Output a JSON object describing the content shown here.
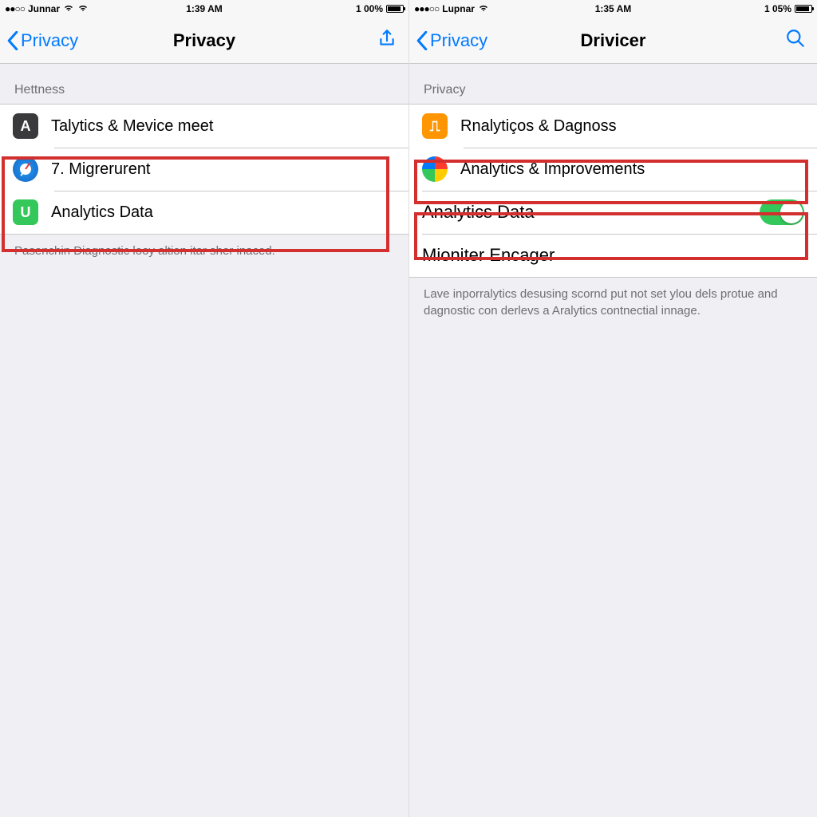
{
  "left": {
    "status": {
      "carrier": "Junnar",
      "signal": "●●○○",
      "time": "1:39 AM",
      "battery": "1 00%"
    },
    "nav": {
      "back": "Privacy",
      "title": "Privacy"
    },
    "section": "Hettness",
    "rows": [
      {
        "label": "Talytics & Mevice meet"
      },
      {
        "label": "7. Migrerurent"
      },
      {
        "label": "Analytics Data"
      }
    ],
    "footer": "Pasenchin Diagnostic looy altion itar sher inaced."
  },
  "right": {
    "status": {
      "carrier": "Lupnar",
      "signal": "●●●○○",
      "time": "1:35 AM",
      "battery": "1 05%"
    },
    "nav": {
      "back": "Privacy",
      "title": "Drivicer"
    },
    "section": "Privacy",
    "rows": [
      {
        "label": "Rnalytiços & Dagnoss"
      },
      {
        "label": "Analytics & Improvements"
      },
      {
        "label": "Analytics Data",
        "toggle": true
      },
      {
        "label": "Mioniter Encager"
      }
    ],
    "footer": "Lave inporralytics desusing scornd put not set ylou dels protue and dagnostic con derlevs a Aralytics contnectial innage."
  }
}
